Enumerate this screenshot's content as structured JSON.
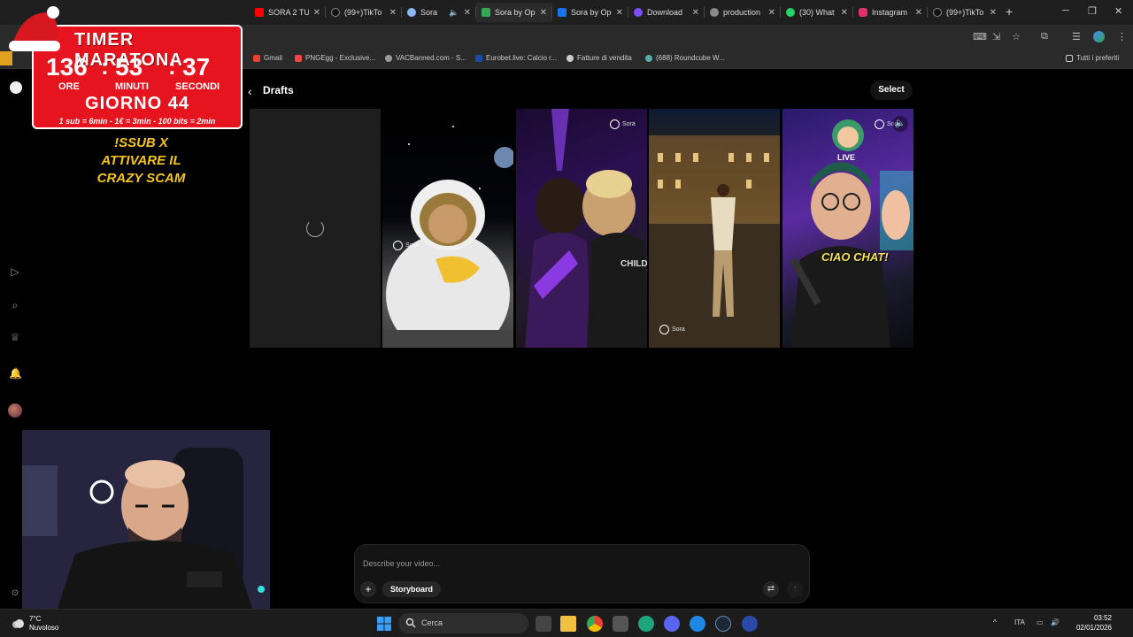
{
  "browser": {
    "tabs": [
      {
        "title": "SORA 2 TU",
        "favicon": "youtube-icon",
        "color": "#ff0000"
      },
      {
        "title": "(99+)TikTo",
        "favicon": "tiktok-icon",
        "color": "#111111"
      },
      {
        "title": "Sora",
        "favicon": "sora-icon",
        "color": "#8ab4f8",
        "active": true
      },
      {
        "title": "Sora by Op",
        "favicon": "play-store-icon",
        "color": "#34a853"
      },
      {
        "title": "Sora by Op",
        "favicon": "app-store-icon",
        "color": "#1a73e8"
      },
      {
        "title": "Download",
        "favicon": "c-icon",
        "color": "#7b4dff"
      },
      {
        "title": "production",
        "favicon": "globe-icon",
        "color": "#888888"
      },
      {
        "title": "(30) What",
        "favicon": "whatsapp-icon",
        "color": "#25d366"
      },
      {
        "title": "Instagram",
        "favicon": "instagram-icon",
        "color": "#e1306c"
      },
      {
        "title": "(99+)TikTo",
        "favicon": "tiktok-icon",
        "color": "#111111"
      }
    ],
    "bookmarks": [
      {
        "label": "Gmail",
        "color": "#ea4335"
      },
      {
        "label": "PNGEgg - Exclusive...",
        "color": "#e44"
      },
      {
        "label": "VACBanned.com - S...",
        "color": "#999"
      },
      {
        "label": "Eurobet.live: Calcio r...",
        "color": "#1a4aa8"
      },
      {
        "label": "Fatture di vendita",
        "color": "#ccc"
      },
      {
        "label": "(688) Roundcube W...",
        "color": "#5aa"
      }
    ],
    "all_bookmarks": "Tutti i preferiti"
  },
  "app": {
    "page_title": "Drafts",
    "select_label": "Select",
    "prompt_placeholder": "Describe your video...",
    "storyboard_label": "Storyboard",
    "sora_watermark": "Sora",
    "live_badge": "LIVE",
    "ciao_chat": "CIAO CHAT!",
    "child_text": "CHILD",
    "drafts": [
      {
        "id": 1,
        "state": "loading"
      },
      {
        "id": 2,
        "subject": "astronaut-on-moon"
      },
      {
        "id": 3,
        "subject": "two-men-stage"
      },
      {
        "id": 4,
        "subject": "man-dancing-piazza"
      },
      {
        "id": 5,
        "subject": "streamer-waving"
      }
    ]
  },
  "overlay": {
    "timer_title": "TIMER MARATONA",
    "hours": "136",
    "minutes": "53",
    "seconds": "37",
    "hours_label": "ORE",
    "minutes_label": "MINUTI",
    "seconds_label": "SECONDI",
    "day": "GIORNO 44",
    "rates": "1 sub = 6min - 1€ = 3min - 100 bits = 2min",
    "promo_line1": "!SSUB X",
    "promo_line2": "ATTIVARE IL",
    "promo_line3": "CRAZY SCAM"
  },
  "taskbar": {
    "temperature": "7°C",
    "weather": "Nuvoloso",
    "search_label": "Cerca",
    "language": "ITA",
    "time": "03:52",
    "date": "02/01/2026"
  }
}
